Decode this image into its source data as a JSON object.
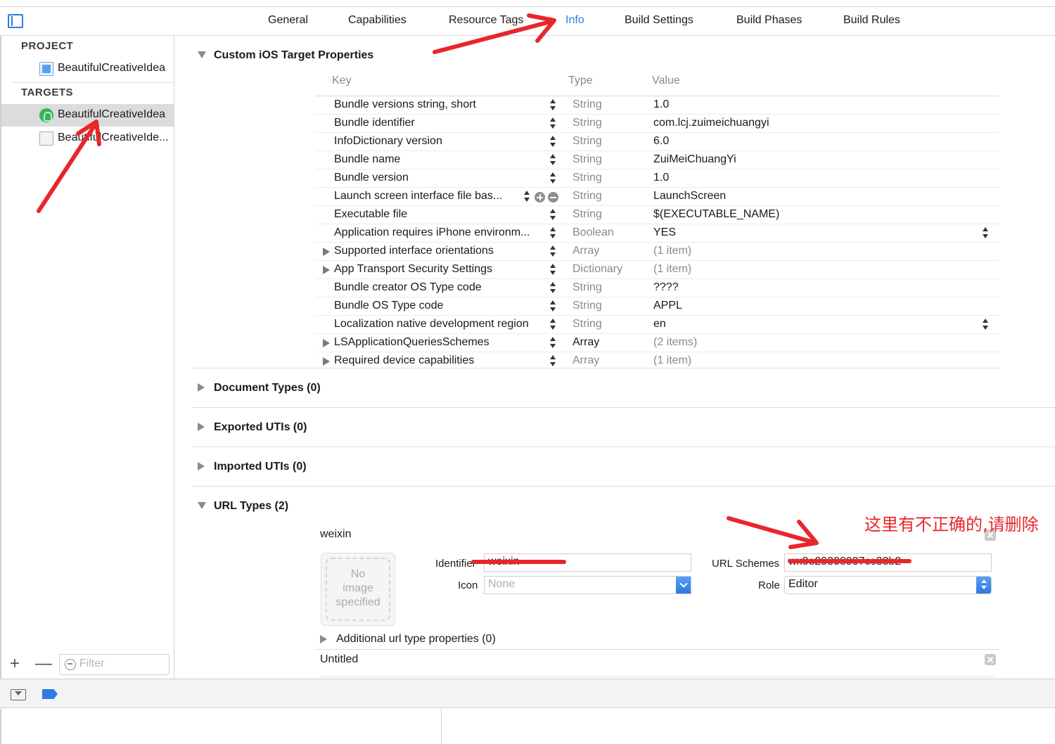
{
  "tabs": [
    "General",
    "Capabilities",
    "Resource Tags",
    "Info",
    "Build Settings",
    "Build Phases",
    "Build Rules"
  ],
  "active_tab": "Info",
  "sidebar": {
    "project_header": "PROJECT",
    "project_item": "BeautifulCreativeIdea",
    "targets_header": "TARGETS",
    "target_items": [
      "BeautifulCreativeIdea",
      "BeautifulCreativeIde..."
    ],
    "filter_placeholder": "Filter",
    "add_label": "+",
    "remove_label": "—"
  },
  "custom_properties": {
    "title": "Custom iOS Target Properties",
    "columns": {
      "key": "Key",
      "type": "Type",
      "value": "Value"
    },
    "rows": [
      {
        "key": "Bundle versions string, short",
        "type": "String",
        "value": "1.0"
      },
      {
        "key": "Bundle identifier",
        "type": "String",
        "value": "com.lcj.zuimeichuangyi"
      },
      {
        "key": "InfoDictionary version",
        "type": "String",
        "value": "6.0"
      },
      {
        "key": "Bundle name",
        "type": "String",
        "value": "ZuiMeiChuangYi"
      },
      {
        "key": "Bundle version",
        "type": "String",
        "value": "1.0"
      },
      {
        "key": "Launch screen interface file bas...",
        "type": "String",
        "value": "LaunchScreen"
      },
      {
        "key": "Executable file",
        "type": "String",
        "value": "$(EXECUTABLE_NAME)"
      },
      {
        "key": "Application requires iPhone environm...",
        "type": "Boolean",
        "value": "YES"
      },
      {
        "key": "Supported interface orientations",
        "type": "Array",
        "value": "(1 item)"
      },
      {
        "key": "App Transport Security Settings",
        "type": "Dictionary",
        "value": "(1 item)"
      },
      {
        "key": "Bundle creator OS Type code",
        "type": "String",
        "value": "????"
      },
      {
        "key": "Bundle OS Type code",
        "type": "String",
        "value": "APPL"
      },
      {
        "key": "Localization native development region",
        "type": "String",
        "value": "en"
      },
      {
        "key": "LSApplicationQueriesSchemes",
        "type": "Array",
        "value": "(2 items)"
      },
      {
        "key": "Required device capabilities",
        "type": "Array",
        "value": "(1 item)"
      }
    ]
  },
  "sections": {
    "document_types": "Document Types (0)",
    "exported_utis": "Exported UTIs (0)",
    "imported_utis": "Imported UTIs (0)",
    "url_types": "URL Types (2)"
  },
  "url_type_1": {
    "name": "weixin",
    "no_image": [
      "No",
      "image",
      "specified"
    ],
    "identifier_label": "Identifier",
    "identifier_value": "weixin",
    "icon_label": "Icon",
    "icon_value": "None",
    "url_schemes_label": "URL Schemes",
    "url_schemes_value": "wx8e29308907cc33b2",
    "role_label": "Role",
    "role_value": "Editor",
    "additional": "Additional url type properties (0)"
  },
  "url_type_2": {
    "name": "Untitled"
  },
  "annotation_text": "这里有不正确的,请删除",
  "colors": {
    "accent": "#2f7be4",
    "annotation_red": "#e8262b"
  }
}
